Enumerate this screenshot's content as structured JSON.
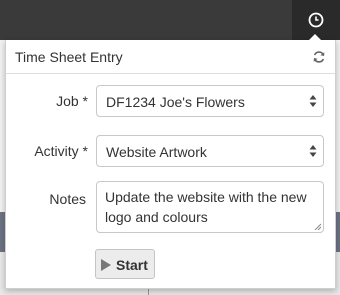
{
  "header": {
    "clock_icon": "clock-icon"
  },
  "panel": {
    "title": "Time Sheet Entry",
    "refresh_icon": "refresh-icon"
  },
  "form": {
    "job": {
      "label": "Job",
      "required_mark": "*",
      "value": "DF1234 Joe's Flowers"
    },
    "activity": {
      "label": "Activity",
      "required_mark": "*",
      "value": "Website Artwork"
    },
    "notes": {
      "label": "Notes",
      "value": "Update the website with the new logo and colours"
    },
    "start_button": {
      "label": "Start",
      "icon": "play-icon"
    }
  },
  "colors": {
    "topbar": "#3a3a3a",
    "clock_button": "#2a2a2a",
    "background_strip": "#6c7384"
  }
}
